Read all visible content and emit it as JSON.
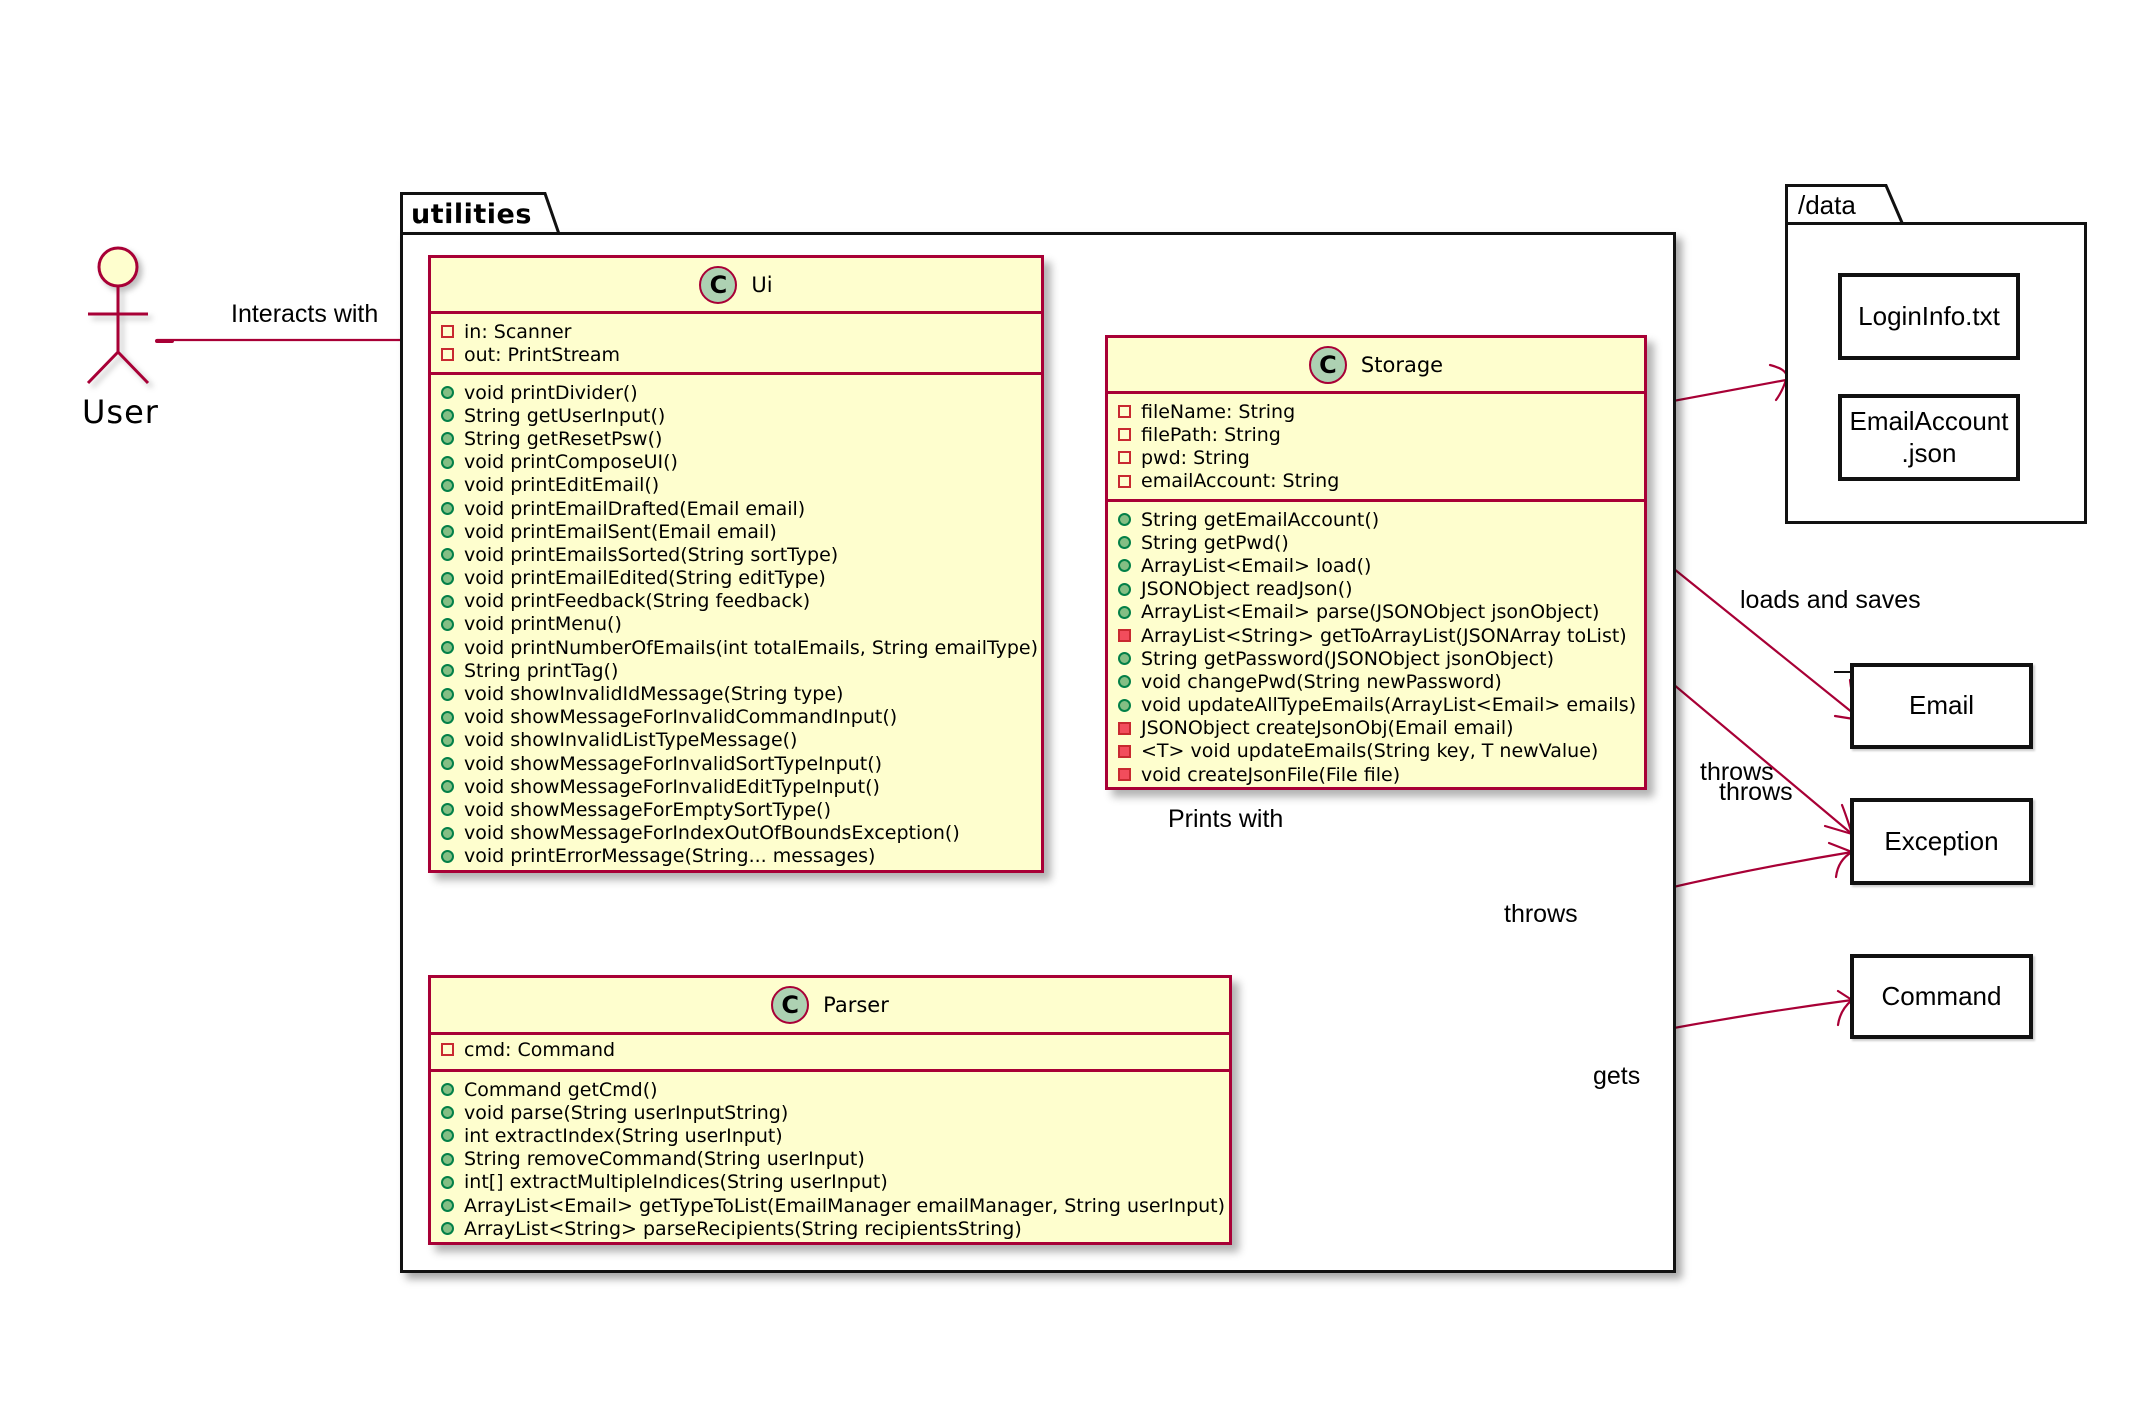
{
  "diagram": {
    "type": "UML class diagram",
    "colors": {
      "class_fill": "#fefece",
      "class_border": "#a80036",
      "class_badge": "#add1b2",
      "edge": "#a80036",
      "package_border": "#111111"
    }
  },
  "actor": {
    "label": "User"
  },
  "packages": {
    "utilities": {
      "label": "utilities"
    },
    "data": {
      "label": "/data",
      "files": [
        {
          "label": "LoginInfo.txt"
        },
        {
          "label": "EmailAccount\n.json",
          "line1": "EmailAccount",
          "line2": ".json"
        }
      ]
    }
  },
  "classes": {
    "ui": {
      "badge": "C",
      "name": "Ui",
      "fields": [
        {
          "visibility": "private",
          "text": "in: Scanner"
        },
        {
          "visibility": "private",
          "text": "out: PrintStream"
        }
      ],
      "methods": [
        {
          "visibility": "public",
          "text": "void printDivider()"
        },
        {
          "visibility": "public",
          "text": "String getUserInput()"
        },
        {
          "visibility": "public",
          "text": "String getResetPsw()"
        },
        {
          "visibility": "public",
          "text": "void printComposeUI()"
        },
        {
          "visibility": "public",
          "text": "void printEditEmail()"
        },
        {
          "visibility": "public",
          "text": "void printEmailDrafted(Email email)"
        },
        {
          "visibility": "public",
          "text": "void printEmailSent(Email email)"
        },
        {
          "visibility": "public",
          "text": "void printEmailsSorted(String sortType)"
        },
        {
          "visibility": "public",
          "text": "void printEmailEdited(String editType)"
        },
        {
          "visibility": "public",
          "text": "void printFeedback(String feedback)"
        },
        {
          "visibility": "public",
          "text": "void printMenu()"
        },
        {
          "visibility": "public",
          "text": "void printNumberOfEmails(int totalEmails, String emailType)"
        },
        {
          "visibility": "public",
          "text": "String printTag()"
        },
        {
          "visibility": "public",
          "text": "void showInvalidIdMessage(String type)"
        },
        {
          "visibility": "public",
          "text": "void showMessageForInvalidCommandInput()"
        },
        {
          "visibility": "public",
          "text": "void showInvalidListTypeMessage()"
        },
        {
          "visibility": "public",
          "text": "void showMessageForInvalidSortTypeInput()"
        },
        {
          "visibility": "public",
          "text": "void showMessageForInvalidEditTypeInput()"
        },
        {
          "visibility": "public",
          "text": "void showMessageForEmptySortType()"
        },
        {
          "visibility": "public",
          "text": "void showMessageForIndexOutOfBoundsException()"
        },
        {
          "visibility": "public",
          "text": "void printErrorMessage(String... messages)"
        }
      ]
    },
    "storage": {
      "badge": "C",
      "name": "Storage",
      "fields": [
        {
          "visibility": "private",
          "text": "fileName: String"
        },
        {
          "visibility": "private",
          "text": "filePath: String"
        },
        {
          "visibility": "private",
          "text": "pwd: String"
        },
        {
          "visibility": "private",
          "text": "emailAccount: String"
        }
      ],
      "methods": [
        {
          "visibility": "public",
          "text": "String getEmailAccount()"
        },
        {
          "visibility": "public",
          "text": "String getPwd()"
        },
        {
          "visibility": "public",
          "text": "ArrayList<Email> load()"
        },
        {
          "visibility": "public",
          "text": "JSONObject readJson()"
        },
        {
          "visibility": "public",
          "text": "ArrayList<Email> parse(JSONObject jsonObject)"
        },
        {
          "visibility": "private",
          "text": "ArrayList<String> getToArrayList(JSONArray toList)"
        },
        {
          "visibility": "public",
          "text": "String getPassword(JSONObject jsonObject)"
        },
        {
          "visibility": "public",
          "text": "void changePwd(String newPassword)"
        },
        {
          "visibility": "public",
          "text": "void updateAllTypeEmails(ArrayList<Email> emails)"
        },
        {
          "visibility": "private",
          "text": "JSONObject createJsonObj(Email email)"
        },
        {
          "visibility": "private",
          "text": "<T> void updateEmails(String key, T newValue)"
        },
        {
          "visibility": "private",
          "text": "void createJsonFile(File file)"
        }
      ]
    },
    "parser": {
      "badge": "C",
      "name": "Parser",
      "fields": [
        {
          "visibility": "private",
          "text": "cmd: Command"
        }
      ],
      "methods": [
        {
          "visibility": "public",
          "text": "Command getCmd()"
        },
        {
          "visibility": "public",
          "text": "void parse(String userInputString)"
        },
        {
          "visibility": "public",
          "text": "int extractIndex(String userInput)"
        },
        {
          "visibility": "public",
          "text": "String removeCommand(String userInput)"
        },
        {
          "visibility": "public",
          "text": "int[] extractMultipleIndices(String userInput)"
        },
        {
          "visibility": "public",
          "text": "ArrayList<Email> getTypeToList(EmailManager emailManager, String userInput)"
        },
        {
          "visibility": "public",
          "text": "ArrayList<String> parseRecipients(String recipientsString)"
        }
      ]
    }
  },
  "external": {
    "email": {
      "label": "Email"
    },
    "exception": {
      "label": "Exception"
    },
    "command": {
      "label": "Command"
    }
  },
  "relations": [
    {
      "id": "user-ui",
      "from": "User",
      "to": "Ui",
      "label": "Interacts with"
    },
    {
      "id": "storage-ui",
      "from": "Storage",
      "to": "Ui",
      "label": "Prints with"
    },
    {
      "id": "storage-data",
      "from": "Storage",
      "to": "/data",
      "label": ""
    },
    {
      "id": "storage-email",
      "from": "Storage",
      "to": "Email",
      "label": "loads and saves"
    },
    {
      "id": "storage-exception",
      "from": "Storage",
      "to": "Exception",
      "label": "throws"
    },
    {
      "id": "storage-exception-2",
      "from": "Storage",
      "to": "Exception",
      "label": "throws"
    },
    {
      "id": "parser-exception",
      "from": "Parser",
      "to": "Exception",
      "label": "throws"
    },
    {
      "id": "parser-command",
      "from": "Parser",
      "to": "Command",
      "label": "gets"
    }
  ]
}
